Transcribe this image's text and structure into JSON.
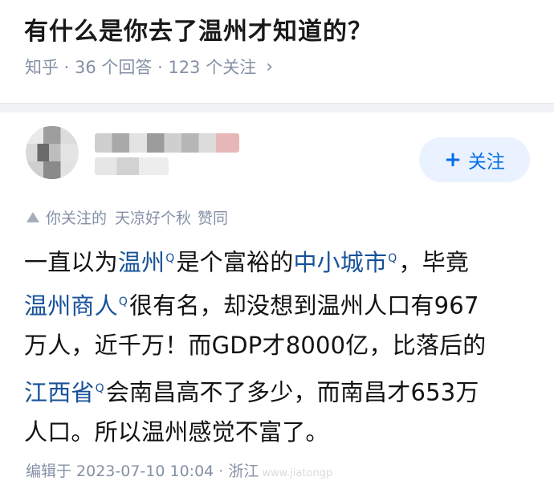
{
  "question": {
    "title": "有什么是你去了温州才知道的？",
    "meta": "知乎 · 36 个回答 · 123 个关注",
    "chevron": "›"
  },
  "answer": {
    "follow_label": "关注",
    "follow_plus": "+",
    "upvote_prefix": "你关注的",
    "upvote_user": "天凉好个秋",
    "upvote_suffix": "赞同",
    "search_mark": "Q",
    "content": {
      "l1_a": "一直以为",
      "l1_kw1": "温州",
      "l1_b": "是个富裕的",
      "l1_kw2": "中小城市",
      "l1_c": "，毕竟",
      "l2_kw": "温州商人",
      "l2_b": "很有名，却没想到温州人口有967",
      "l3": "万人，近千万！而GDP才8000亿，比落后的",
      "l4_kw": "江西省",
      "l4_b": "会南昌高不了多少，而南昌才653万",
      "l5": "人口。所以温州感觉不富了。"
    },
    "edited": "编辑于 2023-07-10 10:04 · 浙江",
    "watermark": "www.jiatongp"
  },
  "colors": {
    "link": "#175199",
    "accent": "#056de8",
    "meta_gray": "#8590a6"
  }
}
